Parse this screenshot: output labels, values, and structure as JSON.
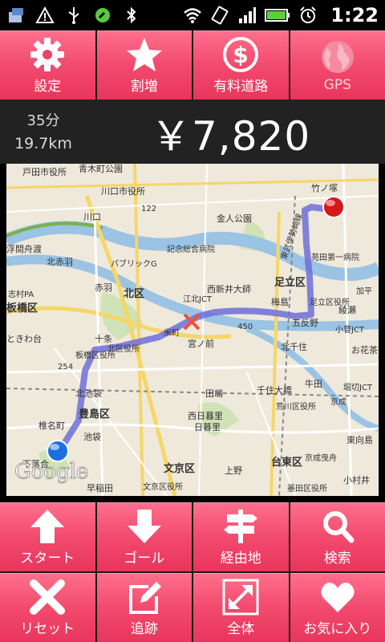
{
  "status_bar": {
    "time": "1:22",
    "icons": [
      "app-notification-icon",
      "warning-icon",
      "usb-icon",
      "sync-icon",
      "bluetooth-icon",
      "wifi-icon",
      "rotate-icon",
      "signal-icon",
      "battery-icon",
      "alarm-icon"
    ]
  },
  "top_buttons": [
    {
      "label": "設定",
      "icon": "gear-icon"
    },
    {
      "label": "割増",
      "icon": "star-icon"
    },
    {
      "label": "有料道路",
      "icon": "dollar-icon"
    },
    {
      "label": "GPS",
      "icon": "globe-icon"
    }
  ],
  "route_info": {
    "duration": "35分",
    "distance": "19.7km",
    "fare": "￥7,820"
  },
  "map": {
    "labels": [
      "戸田市役所",
      "青木町公園",
      "川口市役所",
      "122",
      "川口",
      "金人公園",
      "東武伊勢崎線",
      "竹ノ塚",
      "浮間舟渡",
      "北赤羽",
      "パブリックG",
      "記念総合病院",
      "西新井大師",
      "足立区",
      "苑田第一病院",
      "志村PA",
      "赤羽",
      "梅島",
      "足立区役所",
      "板橋区",
      "北区",
      "江北JCT",
      "450",
      "五反野",
      "綾瀬",
      "ときわ台",
      "十条",
      "宮ノ前",
      "小菅JCT",
      "板橋区役所",
      "北区役所",
      "米町",
      "北千住",
      "お花茶",
      "254",
      "千住大橋",
      "牛田",
      "堀切JCT",
      "北池袋",
      "田端",
      "荒川区役所",
      "豊島区",
      "西日暮里",
      "京成",
      "椎名町",
      "池袋",
      "日暮里",
      "東向島",
      "台東区",
      "下落合",
      "文京区",
      "上野",
      "京成曳舟",
      "早稲田",
      "文京区役所",
      "墨田区役所",
      "小村井",
      "加平",
      "Google"
    ],
    "brand": "Google"
  },
  "bottom_buttons": [
    {
      "label": "スタート",
      "icon": "arrow-up-icon"
    },
    {
      "label": "ゴール",
      "icon": "arrow-down-icon"
    },
    {
      "label": "経由地",
      "icon": "signpost-icon"
    },
    {
      "label": "検索",
      "icon": "search-icon"
    },
    {
      "label": "リセット",
      "icon": "close-icon"
    },
    {
      "label": "追跡",
      "icon": "edit-icon"
    },
    {
      "label": "全体",
      "icon": "expand-icon"
    },
    {
      "label": "お気に入り",
      "icon": "heart-icon"
    }
  ],
  "colors": {
    "button_pink": "#f24a6d",
    "route_blue": "#6f6fd8",
    "background": "#000000"
  }
}
